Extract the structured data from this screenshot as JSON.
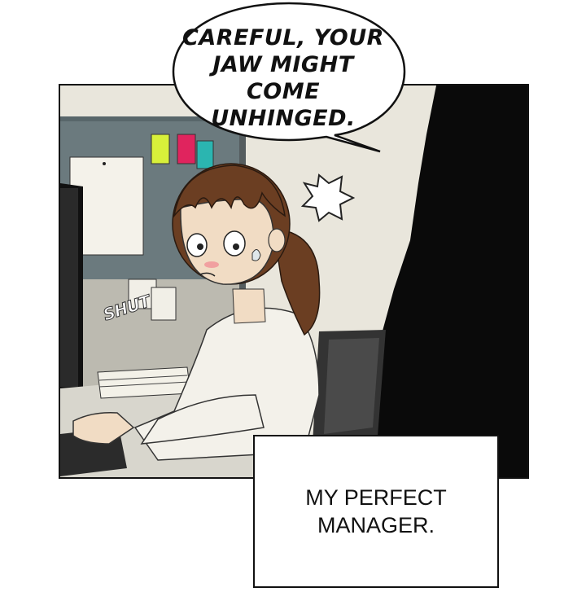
{
  "speech_bubble": {
    "text": "CAREFUL, YOUR\nJAW MIGHT COME\nUNHINGED."
  },
  "sound_effect": {
    "text": "SHUT"
  },
  "caption": {
    "text": "MY PERFECT\nMANAGER."
  },
  "colors": {
    "panel_border": "#111111",
    "wall": "#e9e6dc",
    "cubicle_partition": "#6b7a7e",
    "silhouette": "#0a0a0a",
    "sticky_note_yellow": "#d8f03a",
    "sticky_note_pink": "#e0245e",
    "sticky_note_teal": "#2bb5b0",
    "hair": "#6b3e22",
    "blush": "#f1a0a0"
  }
}
